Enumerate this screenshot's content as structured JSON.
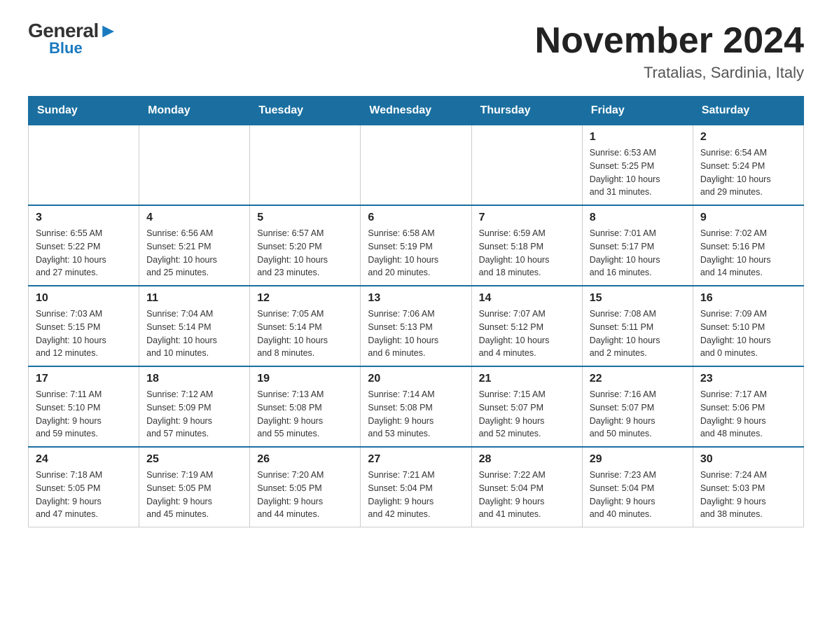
{
  "header": {
    "logo_general": "General",
    "logo_arrow": "▶",
    "logo_blue": "Blue",
    "month_title": "November 2024",
    "location": "Tratalias, Sardinia, Italy"
  },
  "days_of_week": [
    "Sunday",
    "Monday",
    "Tuesday",
    "Wednesday",
    "Thursday",
    "Friday",
    "Saturday"
  ],
  "weeks": [
    [
      {
        "day": "",
        "info": ""
      },
      {
        "day": "",
        "info": ""
      },
      {
        "day": "",
        "info": ""
      },
      {
        "day": "",
        "info": ""
      },
      {
        "day": "",
        "info": ""
      },
      {
        "day": "1",
        "info": "Sunrise: 6:53 AM\nSunset: 5:25 PM\nDaylight: 10 hours\nand 31 minutes."
      },
      {
        "day": "2",
        "info": "Sunrise: 6:54 AM\nSunset: 5:24 PM\nDaylight: 10 hours\nand 29 minutes."
      }
    ],
    [
      {
        "day": "3",
        "info": "Sunrise: 6:55 AM\nSunset: 5:22 PM\nDaylight: 10 hours\nand 27 minutes."
      },
      {
        "day": "4",
        "info": "Sunrise: 6:56 AM\nSunset: 5:21 PM\nDaylight: 10 hours\nand 25 minutes."
      },
      {
        "day": "5",
        "info": "Sunrise: 6:57 AM\nSunset: 5:20 PM\nDaylight: 10 hours\nand 23 minutes."
      },
      {
        "day": "6",
        "info": "Sunrise: 6:58 AM\nSunset: 5:19 PM\nDaylight: 10 hours\nand 20 minutes."
      },
      {
        "day": "7",
        "info": "Sunrise: 6:59 AM\nSunset: 5:18 PM\nDaylight: 10 hours\nand 18 minutes."
      },
      {
        "day": "8",
        "info": "Sunrise: 7:01 AM\nSunset: 5:17 PM\nDaylight: 10 hours\nand 16 minutes."
      },
      {
        "day": "9",
        "info": "Sunrise: 7:02 AM\nSunset: 5:16 PM\nDaylight: 10 hours\nand 14 minutes."
      }
    ],
    [
      {
        "day": "10",
        "info": "Sunrise: 7:03 AM\nSunset: 5:15 PM\nDaylight: 10 hours\nand 12 minutes."
      },
      {
        "day": "11",
        "info": "Sunrise: 7:04 AM\nSunset: 5:14 PM\nDaylight: 10 hours\nand 10 minutes."
      },
      {
        "day": "12",
        "info": "Sunrise: 7:05 AM\nSunset: 5:14 PM\nDaylight: 10 hours\nand 8 minutes."
      },
      {
        "day": "13",
        "info": "Sunrise: 7:06 AM\nSunset: 5:13 PM\nDaylight: 10 hours\nand 6 minutes."
      },
      {
        "day": "14",
        "info": "Sunrise: 7:07 AM\nSunset: 5:12 PM\nDaylight: 10 hours\nand 4 minutes."
      },
      {
        "day": "15",
        "info": "Sunrise: 7:08 AM\nSunset: 5:11 PM\nDaylight: 10 hours\nand 2 minutes."
      },
      {
        "day": "16",
        "info": "Sunrise: 7:09 AM\nSunset: 5:10 PM\nDaylight: 10 hours\nand 0 minutes."
      }
    ],
    [
      {
        "day": "17",
        "info": "Sunrise: 7:11 AM\nSunset: 5:10 PM\nDaylight: 9 hours\nand 59 minutes."
      },
      {
        "day": "18",
        "info": "Sunrise: 7:12 AM\nSunset: 5:09 PM\nDaylight: 9 hours\nand 57 minutes."
      },
      {
        "day": "19",
        "info": "Sunrise: 7:13 AM\nSunset: 5:08 PM\nDaylight: 9 hours\nand 55 minutes."
      },
      {
        "day": "20",
        "info": "Sunrise: 7:14 AM\nSunset: 5:08 PM\nDaylight: 9 hours\nand 53 minutes."
      },
      {
        "day": "21",
        "info": "Sunrise: 7:15 AM\nSunset: 5:07 PM\nDaylight: 9 hours\nand 52 minutes."
      },
      {
        "day": "22",
        "info": "Sunrise: 7:16 AM\nSunset: 5:07 PM\nDaylight: 9 hours\nand 50 minutes."
      },
      {
        "day": "23",
        "info": "Sunrise: 7:17 AM\nSunset: 5:06 PM\nDaylight: 9 hours\nand 48 minutes."
      }
    ],
    [
      {
        "day": "24",
        "info": "Sunrise: 7:18 AM\nSunset: 5:05 PM\nDaylight: 9 hours\nand 47 minutes."
      },
      {
        "day": "25",
        "info": "Sunrise: 7:19 AM\nSunset: 5:05 PM\nDaylight: 9 hours\nand 45 minutes."
      },
      {
        "day": "26",
        "info": "Sunrise: 7:20 AM\nSunset: 5:05 PM\nDaylight: 9 hours\nand 44 minutes."
      },
      {
        "day": "27",
        "info": "Sunrise: 7:21 AM\nSunset: 5:04 PM\nDaylight: 9 hours\nand 42 minutes."
      },
      {
        "day": "28",
        "info": "Sunrise: 7:22 AM\nSunset: 5:04 PM\nDaylight: 9 hours\nand 41 minutes."
      },
      {
        "day": "29",
        "info": "Sunrise: 7:23 AM\nSunset: 5:04 PM\nDaylight: 9 hours\nand 40 minutes."
      },
      {
        "day": "30",
        "info": "Sunrise: 7:24 AM\nSunset: 5:03 PM\nDaylight: 9 hours\nand 38 minutes."
      }
    ]
  ]
}
